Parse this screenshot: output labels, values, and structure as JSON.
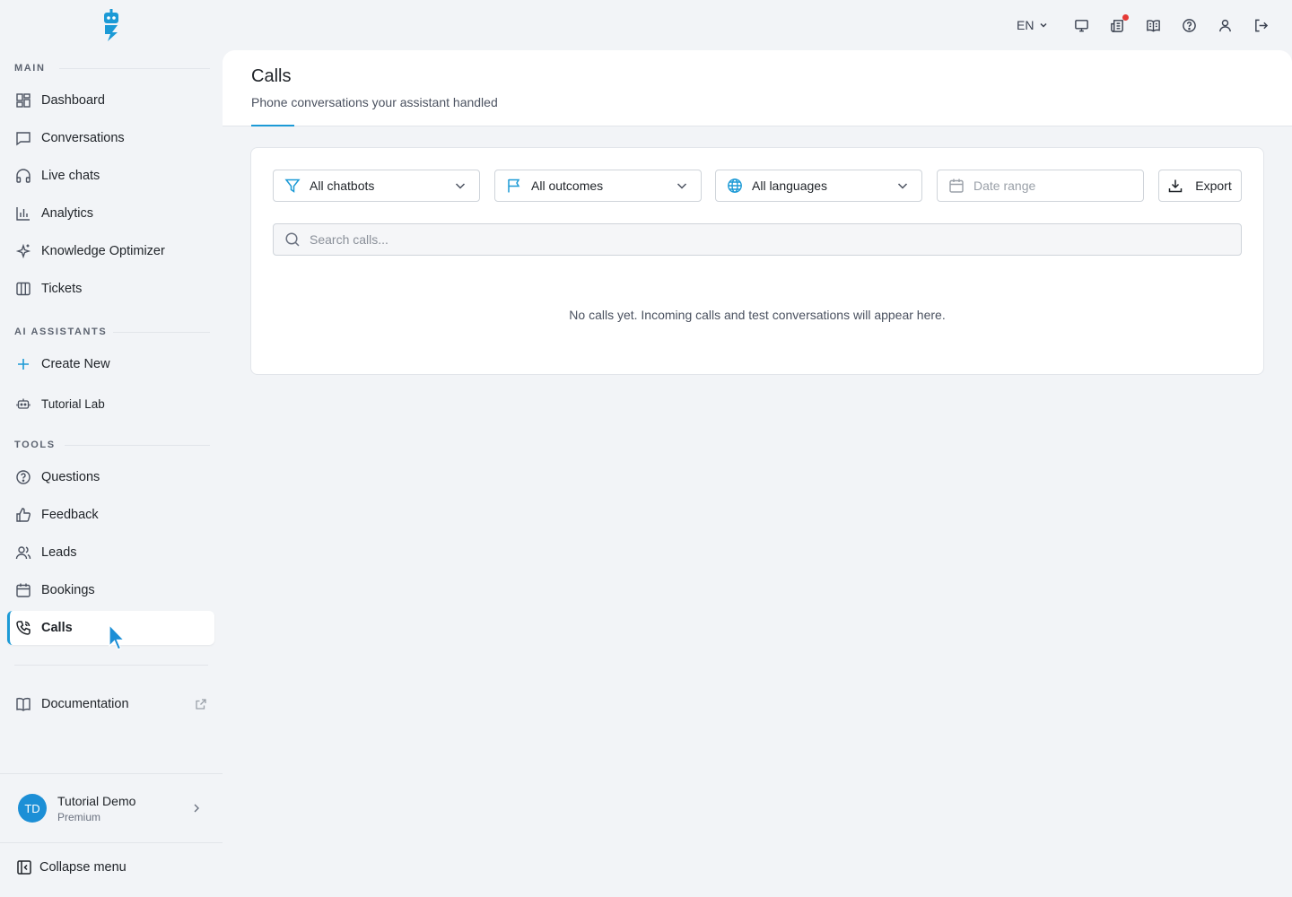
{
  "sidebar": {
    "sections": {
      "main": "MAIN",
      "ai_assistants": "AI ASSISTANTS",
      "tools": "TOOLS"
    },
    "main_items": [
      {
        "label": "Dashboard",
        "icon": "dashboard-icon"
      },
      {
        "label": "Conversations",
        "icon": "chat-icon"
      },
      {
        "label": "Live chats",
        "icon": "headphones-icon"
      },
      {
        "label": "Analytics",
        "icon": "bar-chart-icon"
      },
      {
        "label": "Knowledge Optimizer",
        "icon": "sparkles-icon"
      },
      {
        "label": "Tickets",
        "icon": "columns-icon"
      }
    ],
    "assistant_items": [
      {
        "label": "Create New",
        "icon": "plus-icon"
      },
      {
        "label": "Tutorial Lab",
        "icon": "bot-icon"
      }
    ],
    "tool_items": [
      {
        "label": "Questions",
        "icon": "question-circle-icon"
      },
      {
        "label": "Feedback",
        "icon": "thumbs-up-icon"
      },
      {
        "label": "Leads",
        "icon": "users-icon"
      },
      {
        "label": "Bookings",
        "icon": "calendar-icon"
      },
      {
        "label": "Calls",
        "icon": "phone-icon",
        "active": true
      }
    ],
    "documentation": {
      "label": "Documentation",
      "icon": "book-icon"
    },
    "user": {
      "initials": "TD",
      "name": "Tutorial Demo",
      "plan": "Premium"
    },
    "collapse_label": "Collapse menu"
  },
  "topbar": {
    "language": "EN",
    "icons": [
      "monitor-icon",
      "news-icon",
      "book-open-icon",
      "help-icon",
      "user-icon",
      "logout-icon"
    ]
  },
  "page": {
    "title": "Calls",
    "subtitle": "Phone conversations your assistant handled"
  },
  "filters": {
    "chatbots": "All chatbots",
    "outcomes": "All outcomes",
    "languages": "All languages",
    "date_placeholder": "Date range",
    "export_label": "Export"
  },
  "search": {
    "placeholder": "Search calls..."
  },
  "empty_state": "No calls yet. Incoming calls and test conversations will appear here.",
  "colors": {
    "accent": "#1c9ad6",
    "avatar": "#1c8fd6",
    "notification": "#e53935"
  }
}
